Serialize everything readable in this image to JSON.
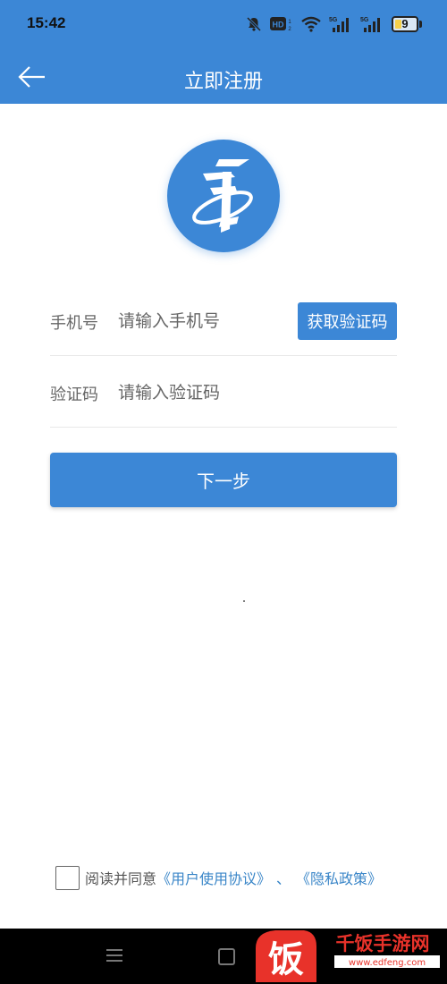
{
  "status_bar": {
    "time": "15:42",
    "battery": "9",
    "network_1": "5G",
    "network_2": "5G",
    "hd_badge": "HD"
  },
  "header": {
    "title": "立即注册",
    "back_icon": "arrow-left-icon"
  },
  "form": {
    "phone": {
      "label": "手机号",
      "value": "",
      "placeholder": "请输入手机号"
    },
    "get_code_button": "获取验证码",
    "code": {
      "label": "验证码",
      "value": "",
      "placeholder": "请输入验证码"
    },
    "next_button": "下一步"
  },
  "agreement": {
    "checked": false,
    "prefix": "阅读并同意",
    "user_agreement": "《用户使用协议》",
    "separator": "、",
    "privacy_policy": "《隐私政策》"
  },
  "watermark": {
    "brand_char": "饭",
    "brand_name": "千饭手游网",
    "url": "www.edfeng.com"
  },
  "colors": {
    "primary": "#3c87d6",
    "link": "#3a86c8",
    "watermark": "#e8322a"
  }
}
